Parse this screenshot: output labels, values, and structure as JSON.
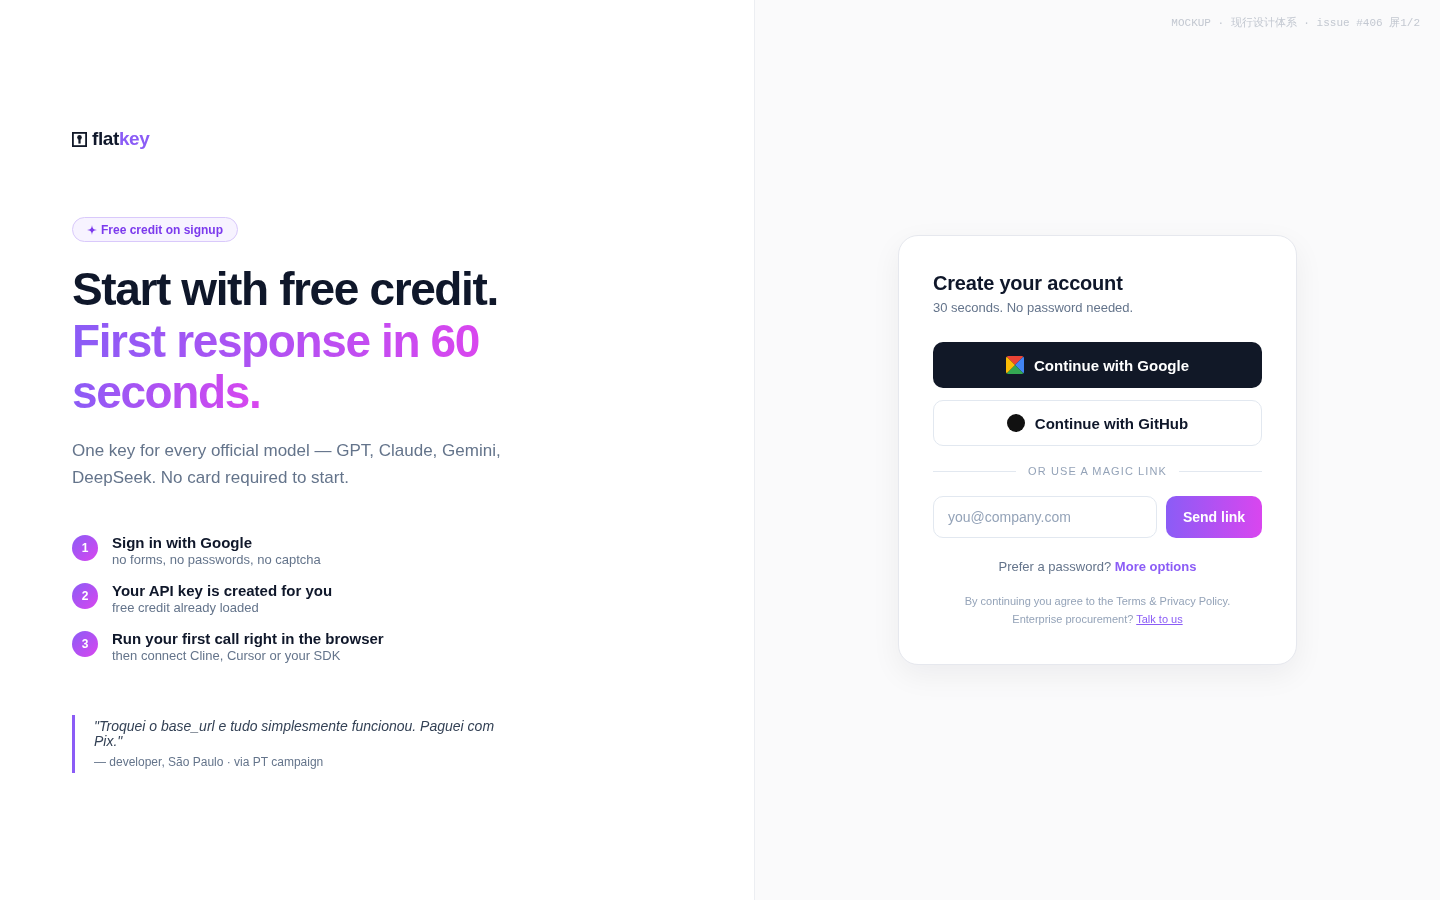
{
  "mockup_label": "MOCKUP · 现行设计体系 · issue #406 屏1/2",
  "brand": {
    "name": "flat",
    "accent": "key"
  },
  "promo": {
    "label": "Free credit on signup"
  },
  "headline": {
    "text": "Start with free credit.",
    "highlight": "First response in 60 seconds."
  },
  "description": "One key for every official model — GPT, Claude, Gemini, DeepSeek. No card required to start.",
  "steps": [
    {
      "number": "1",
      "title": "Sign in with Google",
      "detail": "no forms, no passwords, no captcha"
    },
    {
      "number": "2",
      "title": "Your API key is created for you",
      "detail": "free credit already loaded"
    },
    {
      "number": "3",
      "title": "Run your first call right in the browser",
      "detail": "then connect Cline, Cursor or your SDK"
    }
  ],
  "testimonial": {
    "quote": "\"Troquei o base_url e tudo simplesmente funcionou. Paguei com Pix.\"",
    "attribution": "— developer, São Paulo · via PT campaign"
  },
  "signup": {
    "title": "Create your account",
    "subtitle": "30 seconds. No password needed.",
    "providers": [
      {
        "kind": "google",
        "label": "Continue with Google"
      },
      {
        "kind": "github",
        "label": "Continue with GitHub"
      }
    ],
    "divider": "OR USE A MAGIC LINK",
    "email": {
      "placeholder": "you@company.com"
    },
    "send_button": "Send link",
    "password_prompt": "Prefer a password?",
    "password_link": "More options",
    "legal": "By continuing you agree to the Terms & Privacy Policy.",
    "enterprise_prompt": "Enterprise procurement?",
    "enterprise_link": "Talk to us"
  }
}
